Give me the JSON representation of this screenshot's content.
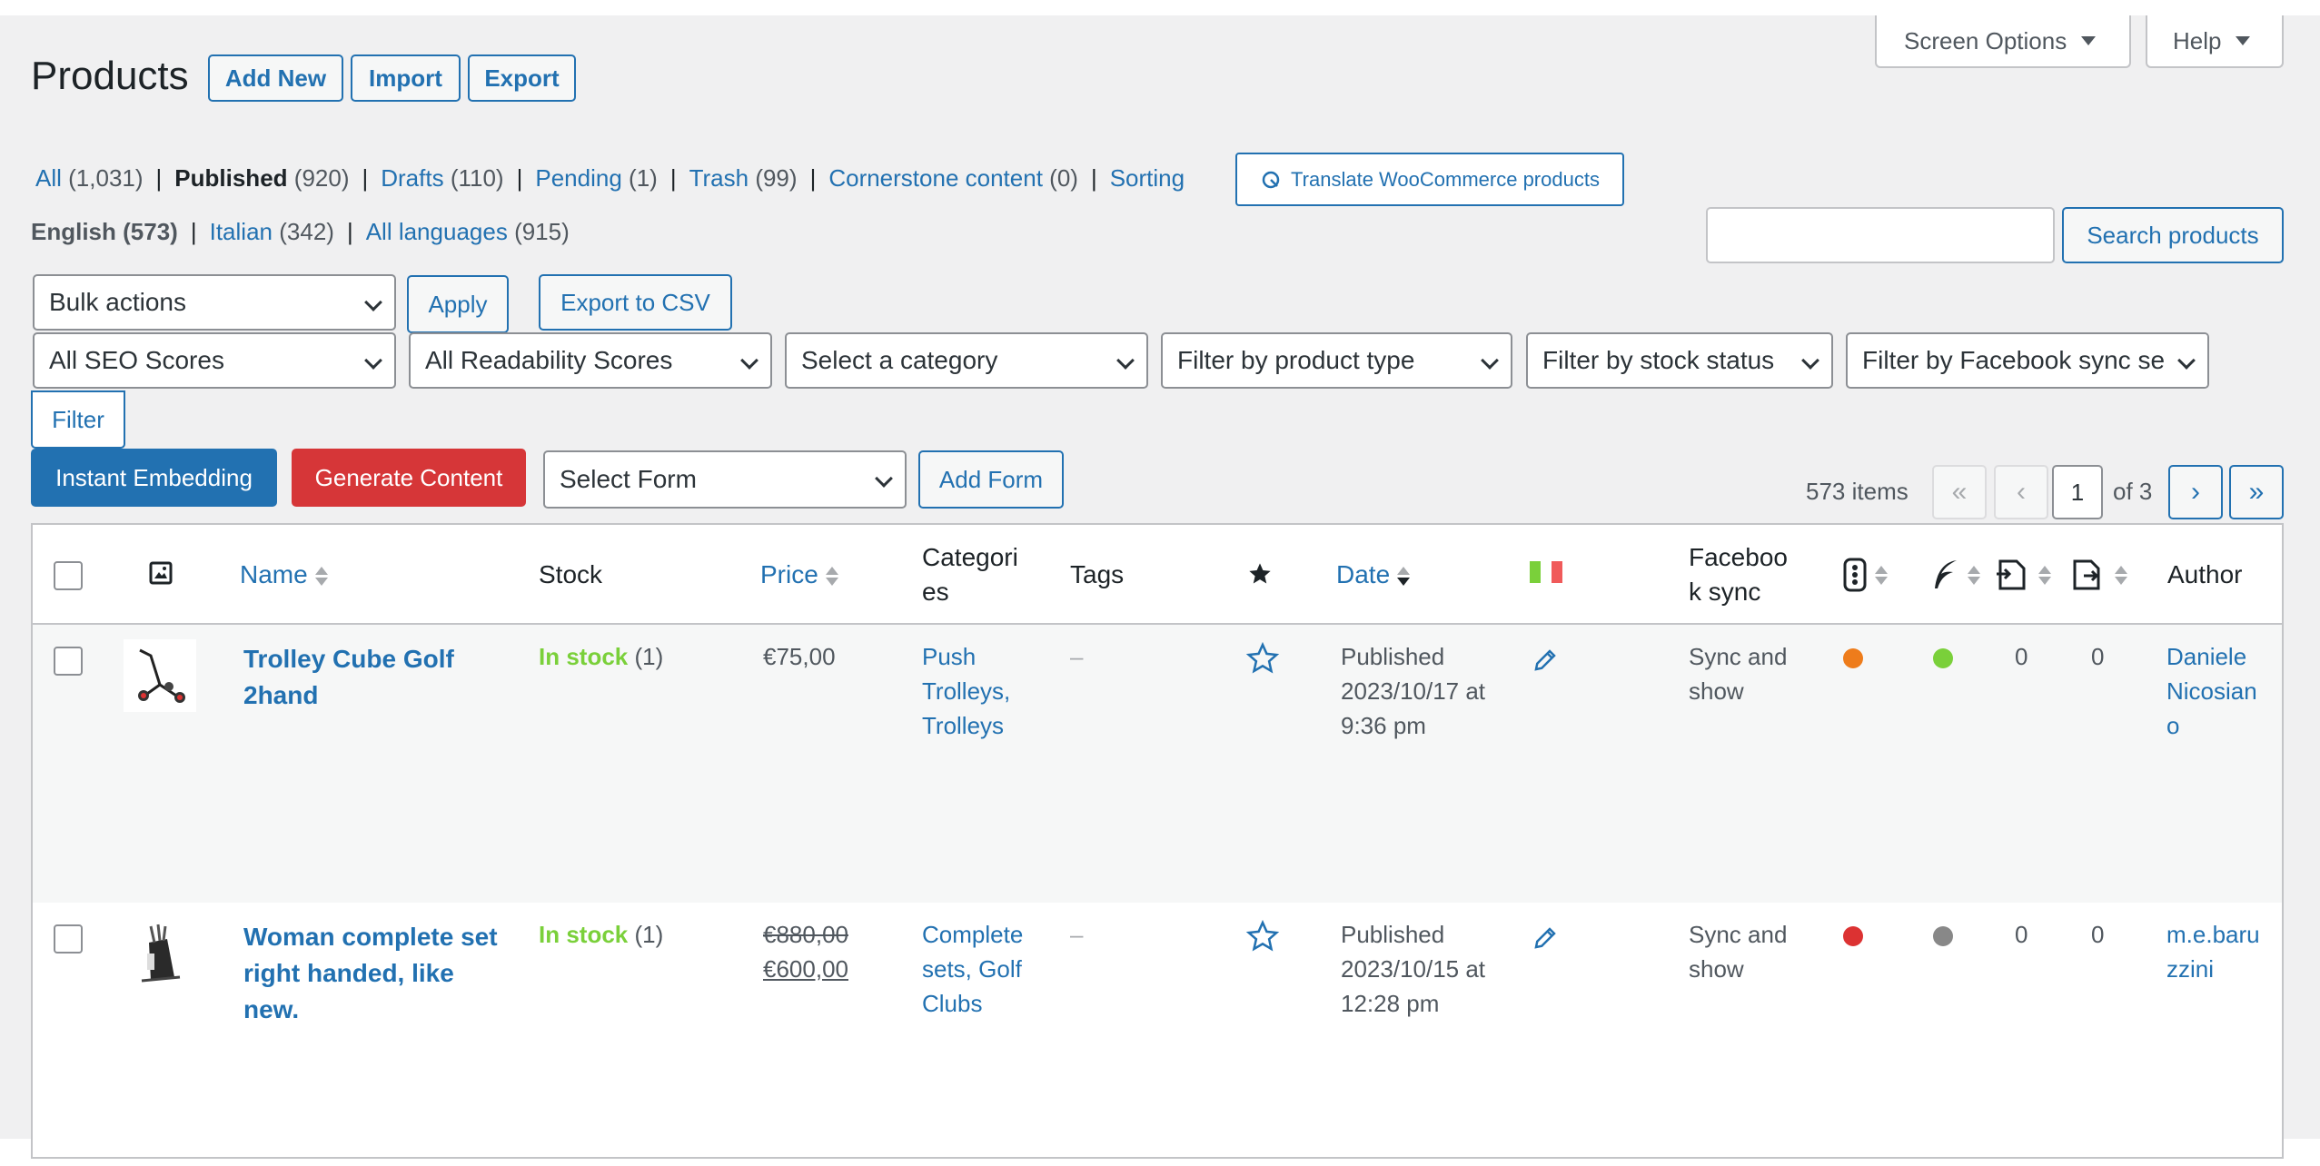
{
  "header": {
    "title": "Products",
    "add_new": "Add New",
    "import": "Import",
    "export": "Export",
    "screen_options": "Screen Options",
    "help": "Help"
  },
  "views": [
    {
      "label": "All",
      "count": "(1,031)",
      "current": false
    },
    {
      "label": "Published",
      "count": "(920)",
      "current": true
    },
    {
      "label": "Drafts",
      "count": "(110)",
      "current": false
    },
    {
      "label": "Pending",
      "count": "(1)",
      "current": false
    },
    {
      "label": "Trash",
      "count": "(99)",
      "current": false
    },
    {
      "label": "Cornerstone content",
      "count": "(0)",
      "current": false
    },
    {
      "label": "Sorting",
      "count": "",
      "current": false
    }
  ],
  "languages": [
    {
      "label": "English",
      "count": "(573)",
      "current": true
    },
    {
      "label": "Italian",
      "count": "(342)",
      "current": false
    },
    {
      "label": "All languages",
      "count": "(915)",
      "current": false
    }
  ],
  "translate_button": "Translate WooCommerce products",
  "search": {
    "value": "",
    "button": "Search products"
  },
  "bulk": {
    "select": "Bulk actions",
    "apply": "Apply",
    "export_csv": "Export to CSV"
  },
  "filters": {
    "seo": "All SEO Scores",
    "readability": "All Readability Scores",
    "category": "Select a category",
    "product_type": "Filter by product type",
    "stock_status": "Filter by stock status",
    "facebook_sync": "Filter by Facebook sync setting",
    "filter_button": "Filter"
  },
  "actions": {
    "instant_embedding": "Instant Embedding",
    "generate_content": "Generate Content",
    "select_form": "Select Form",
    "add_form": "Add Form"
  },
  "pagination": {
    "items": "573 items",
    "first": "«",
    "prev": "‹",
    "current": "1",
    "of": "of 3",
    "next": "›",
    "last": "»"
  },
  "columns": {
    "name": "Name",
    "stock": "Stock",
    "price": "Price",
    "categories": "Categori es",
    "tags": "Tags",
    "date": "Date",
    "facebook": "Faceboo k sync",
    "author": "Author"
  },
  "colors": {
    "accent": "#2271b1",
    "danger": "#d63638",
    "in_stock": "#7ad03a",
    "seo_ok": "#ee7c1b",
    "read_good": "#7ad03a",
    "seo_bad": "#dc3232",
    "read_na": "#888888"
  },
  "rows": [
    {
      "name_line1": "Trolley Cube Golf",
      "name_line2": "2hand",
      "name_line3": "",
      "stock_label": "In stock",
      "stock_count": "(1)",
      "price_old": "",
      "price": "€75,00",
      "cat1": "Push",
      "cat2": "Trolleys,",
      "cat3": "Trolleys",
      "tags": "–",
      "date1": "Published",
      "date2": "2023/10/17 at",
      "date3": "9:36 pm",
      "fb1": "Sync and",
      "fb2": "show",
      "links_in": "0",
      "links_out": "0",
      "author1": "Daniele",
      "author2": "Nicosian",
      "author3": "o",
      "seo_color": "#ee7c1b",
      "read_color": "#7ad03a",
      "thumb_icon": "golf-trolley-image"
    },
    {
      "name_line1": "Woman complete set",
      "name_line2": "right handed, like",
      "name_line3": "new.",
      "stock_label": "In stock",
      "stock_count": "(1)",
      "price_old": "€880,00",
      "price": "€600,00",
      "cat1": "Complete",
      "cat2": "sets, Golf",
      "cat3": "Clubs",
      "tags": "–",
      "date1": "Published",
      "date2": "2023/10/15 at",
      "date3": "12:28 pm",
      "fb1": "Sync and",
      "fb2": "show",
      "links_in": "0",
      "links_out": "0",
      "author1": "m.e.baru",
      "author2": "zzini",
      "author3": "",
      "seo_color": "#dc3232",
      "read_color": "#888888",
      "thumb_icon": "golf-bag-image"
    }
  ]
}
